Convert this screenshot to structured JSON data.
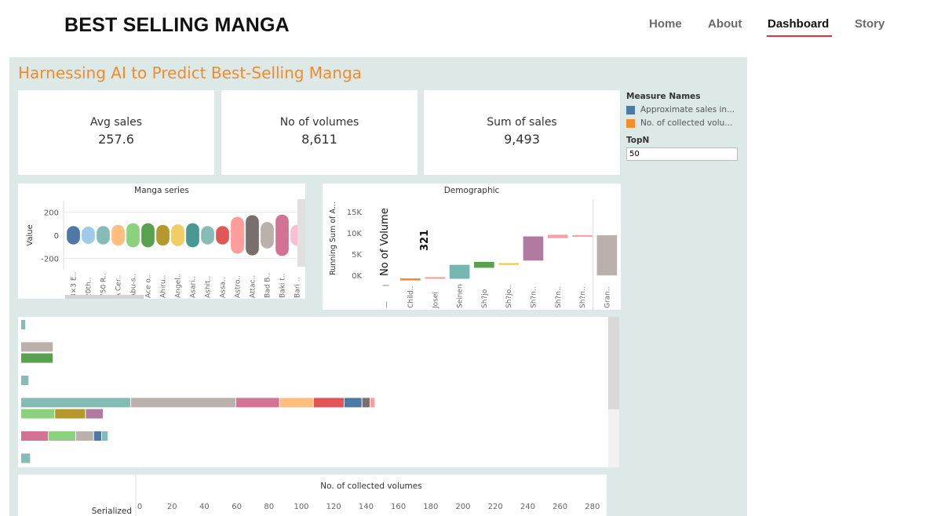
{
  "header": {
    "brand": "BEST SELLING MANGA",
    "nav": [
      {
        "label": "Home",
        "active": false
      },
      {
        "label": "About",
        "active": false
      },
      {
        "label": "Dashboard",
        "active": true
      },
      {
        "label": "Story",
        "active": false
      }
    ]
  },
  "dashboard": {
    "title": "Harnessing AI to Predict Best-Selling Manga",
    "kpis": [
      {
        "label": "Avg sales",
        "value": "257.6"
      },
      {
        "label": "No of volumes",
        "value": "8,611"
      },
      {
        "label": "Sum of sales",
        "value": "9,493"
      }
    ],
    "legend": {
      "title": "Measure Names",
      "items": [
        {
          "label": "Approximate sales in...",
          "color": "#4e79a7"
        },
        {
          "label": "No. of collected volu...",
          "color": "#f28e2b"
        }
      ],
      "topn_label": "TopN",
      "topn_value": "50"
    },
    "manga_series": {
      "title": "Manga series",
      "ylabel": "Value"
    },
    "demographic": {
      "title": "Demographic",
      "ylabel": "Running Sum of A...",
      "annotation_label": "No of Volume",
      "annotation_value": "321"
    },
    "volumes_chart": {
      "title": "No. of collected volumes",
      "row_label": "Serialized"
    }
  },
  "chart_data": [
    {
      "type": "bar",
      "title": "Manga series",
      "ylabel": "Value",
      "categories": [
        "3×3 E..",
        "20th..",
        "750 R..",
        "A Cer..",
        "Abu-s..",
        "Ace o..",
        "Ahiru..",
        "Angel..",
        "Asari..",
        "Ashit..",
        "Assa..",
        "Astro..",
        "Attac..",
        "Bad B..",
        "Baki t..",
        "Bari .."
      ],
      "values": [
        80,
        75,
        80,
        90,
        105,
        105,
        90,
        95,
        105,
        80,
        80,
        160,
        175,
        115,
        180,
        90
      ],
      "colors": [
        "#4e79a7",
        "#a0cbe8",
        "#86bcb6",
        "#ffbe7d",
        "#8cd17d",
        "#59a14f",
        "#b6992d",
        "#f1ce63",
        "#499894",
        "#86bcb6",
        "#e15759",
        "#ff9d9a",
        "#79706e",
        "#bab0ac",
        "#d37295",
        "#fabfd2"
      ],
      "yticks": [
        200,
        0,
        -200
      ],
      "ylim": [
        -300,
        300
      ]
    },
    {
      "type": "bar",
      "title": "Demographic",
      "ylabel": "Running Sum of A...",
      "categories": [
        "—",
        "Child..",
        "Josei",
        "Seinen",
        "Sh?jo",
        "Sh?jo..",
        "Sh?n..",
        "Sh?n..",
        "Sh?n..",
        "Gran.."
      ],
      "ranges": [
        [
          0,
          0
        ],
        [
          -700,
          -1200
        ],
        [
          -400,
          -800
        ],
        [
          -800,
          2500
        ],
        [
          1800,
          3200
        ],
        [
          2500,
          2900
        ],
        [
          3500,
          9200
        ],
        [
          8800,
          9600
        ],
        [
          9200,
          9500
        ],
        [
          0,
          9500
        ]
      ],
      "colors": [
        "#ffffff",
        "#f28e2b",
        "#ff9d9a",
        "#76b7b2",
        "#59a14f",
        "#edc948",
        "#b07aa1",
        "#ff9da7",
        "#ff9d9a",
        "#bab0ac"
      ],
      "yticks": [
        "15K",
        "10K",
        "5K",
        "0K"
      ],
      "ylim": [
        -2000,
        18000
      ]
    },
    {
      "type": "bar",
      "title": "No. of collected volumes",
      "xlabel": "No. of collected volumes",
      "xticks": [
        0,
        20,
        40,
        60,
        80,
        100,
        120,
        140,
        160,
        180,
        200,
        220,
        240,
        260,
        280
      ],
      "rows": [
        [
          {
            "v": 3,
            "c": "#86bcb6"
          }
        ],
        [],
        [
          {
            "v": 20,
            "c": "#bab0ac"
          }
        ],
        [
          {
            "v": 20,
            "c": "#59a14f"
          }
        ],
        [],
        [
          {
            "v": 5,
            "c": "#86bcb6"
          }
        ],
        [],
        [
          {
            "v": 68,
            "c": "#86bcb6"
          },
          {
            "v": 65,
            "c": "#bab0ac"
          },
          {
            "v": 27,
            "c": "#d37295"
          },
          {
            "v": 21,
            "c": "#ffbe7d"
          },
          {
            "v": 19,
            "c": "#e15759"
          },
          {
            "v": 11,
            "c": "#4e79a7"
          },
          {
            "v": 5,
            "c": "#79706e"
          },
          {
            "v": 3,
            "c": "#ff9d9a"
          }
        ],
        [
          {
            "v": 21,
            "c": "#8cd17d"
          },
          {
            "v": 19,
            "c": "#b6992d"
          },
          {
            "v": 11,
            "c": "#b07aa1"
          }
        ],
        [],
        [
          {
            "v": 17,
            "c": "#d37295"
          },
          {
            "v": 17,
            "c": "#8cd17d"
          },
          {
            "v": 11,
            "c": "#bab0ac"
          },
          {
            "v": 5,
            "c": "#4e79a7"
          },
          {
            "v": 4,
            "c": "#86bcb6"
          }
        ],
        [],
        [
          {
            "v": 6,
            "c": "#86bcb6"
          }
        ]
      ]
    }
  ]
}
